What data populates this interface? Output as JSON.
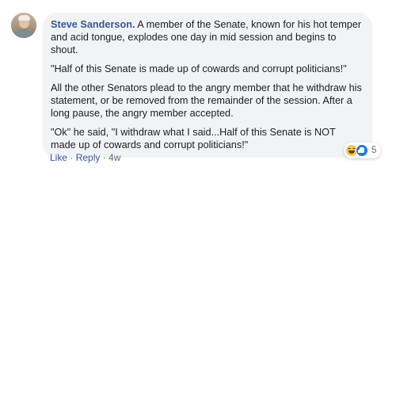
{
  "comment": {
    "author": "Steve Sanderson.",
    "paragraphs": [
      " A member of the Senate, known for his hot temper and acid tongue, explodes one day in mid session and begins to shout.",
      "\"Half of this Senate is made up of cowards and corrupt politicians!\"",
      "All the other Senators plead to the angry member that he withdraw his statement, or be removed from the remainder of the session. After a long pause, the angry member accepted.",
      "\"Ok\" he said, \"I withdraw what I said...Half of this Senate is NOT made up of cowards and corrupt politicians!\""
    ],
    "reactions": {
      "icons": [
        "haha-reaction-icon",
        "like-reaction-icon"
      ],
      "count": "5"
    },
    "actions": {
      "like": "Like",
      "reply": "Reply",
      "separator": " · ",
      "time": "4w"
    }
  },
  "colors": {
    "author_link": "#385898",
    "bubble_bg": "#f2f3f5",
    "meta_text": "#606770",
    "like_blue": "#1877f2",
    "haha_yellow": "#f7c53f"
  }
}
